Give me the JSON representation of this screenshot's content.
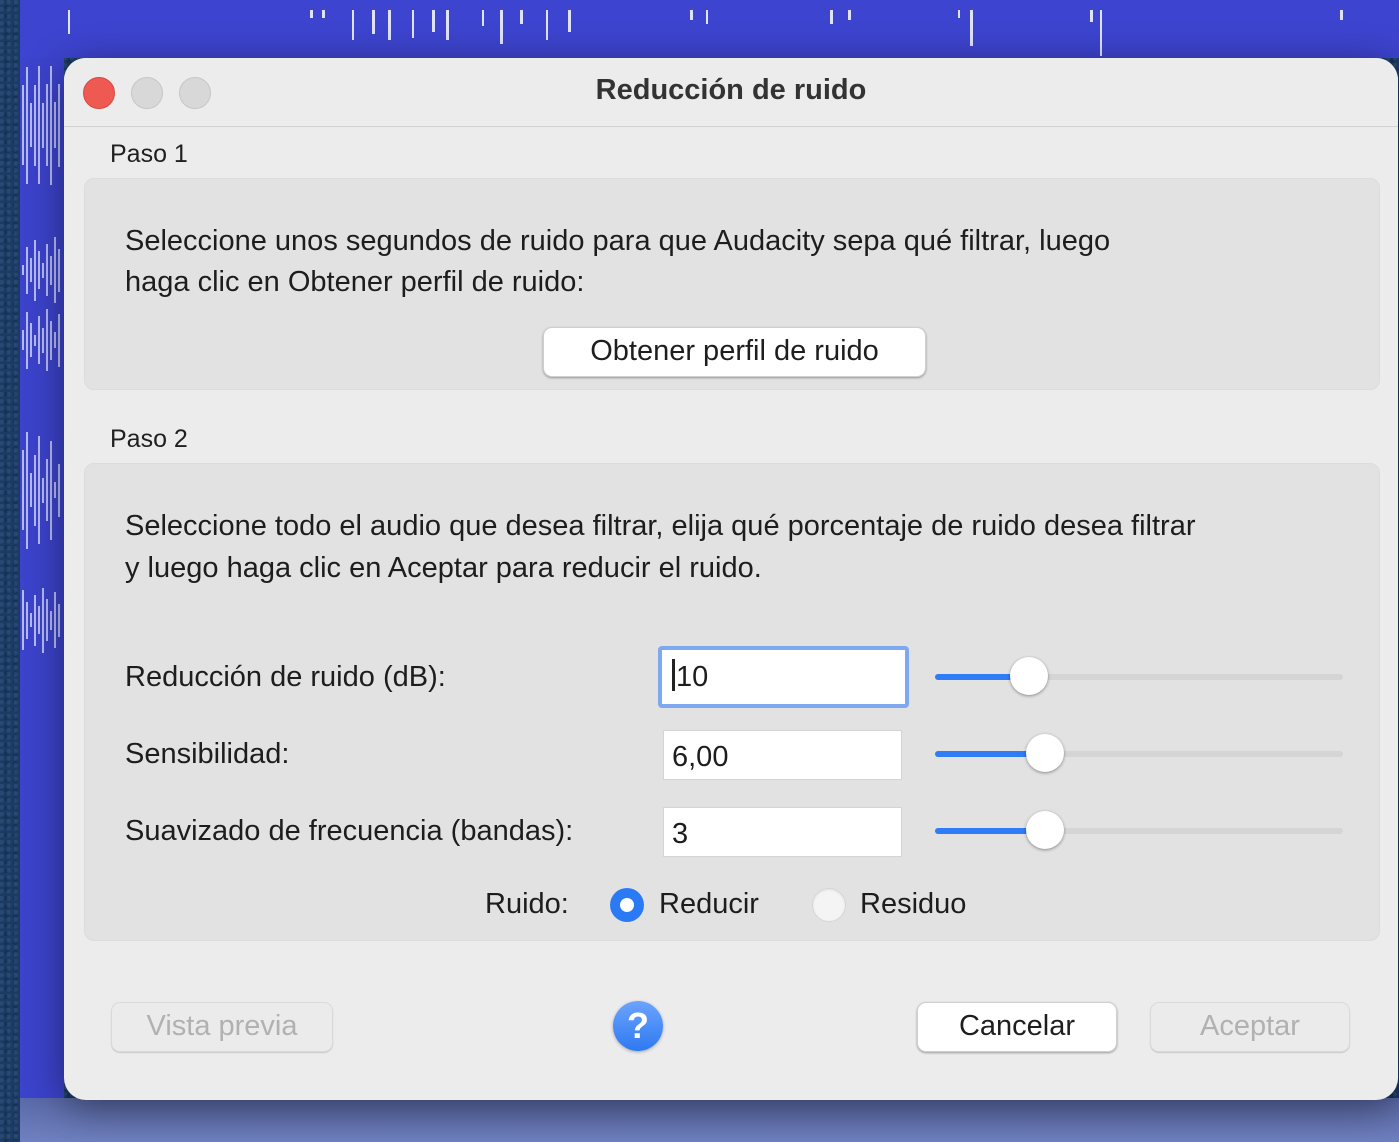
{
  "dialog": {
    "title": "Reducción de ruido"
  },
  "step1": {
    "label": "Paso 1",
    "instructions_line1": "Seleccione unos segundos de ruido para que Audacity sepa qué filtrar, luego",
    "instructions_line2": "haga clic en Obtener perfil de ruido:",
    "get_profile_button": "Obtener perfil de ruido"
  },
  "step2": {
    "label": "Paso 2",
    "instructions_line1": "Seleccione todo el audio que desea filtrar, elija qué porcentaje de ruido desea filtrar",
    "instructions_line2": "y luego haga clic en Aceptar para reducir el ruido.",
    "noise_reduction": {
      "label": "Reducción de ruido (dB):",
      "value": "10",
      "slider_fraction": 0.23
    },
    "sensitivity": {
      "label": "Sensibilidad:",
      "value": "6,00",
      "slider_fraction": 0.27
    },
    "frequency_smoothing": {
      "label": "Suavizado de frecuencia (bandas):",
      "value": "3",
      "slider_fraction": 0.27
    },
    "noise_mode": {
      "label": "Ruido:",
      "options": [
        "Reducir",
        "Residuo"
      ],
      "selected": "Reducir"
    }
  },
  "footer": {
    "preview_button": "Vista previa",
    "help_button": "?",
    "cancel_button": "Cancelar",
    "ok_button": "Aceptar"
  },
  "colors": {
    "accent": "#2f7cf6",
    "close": "#ee5a52",
    "background_track": "#3d44cf"
  }
}
